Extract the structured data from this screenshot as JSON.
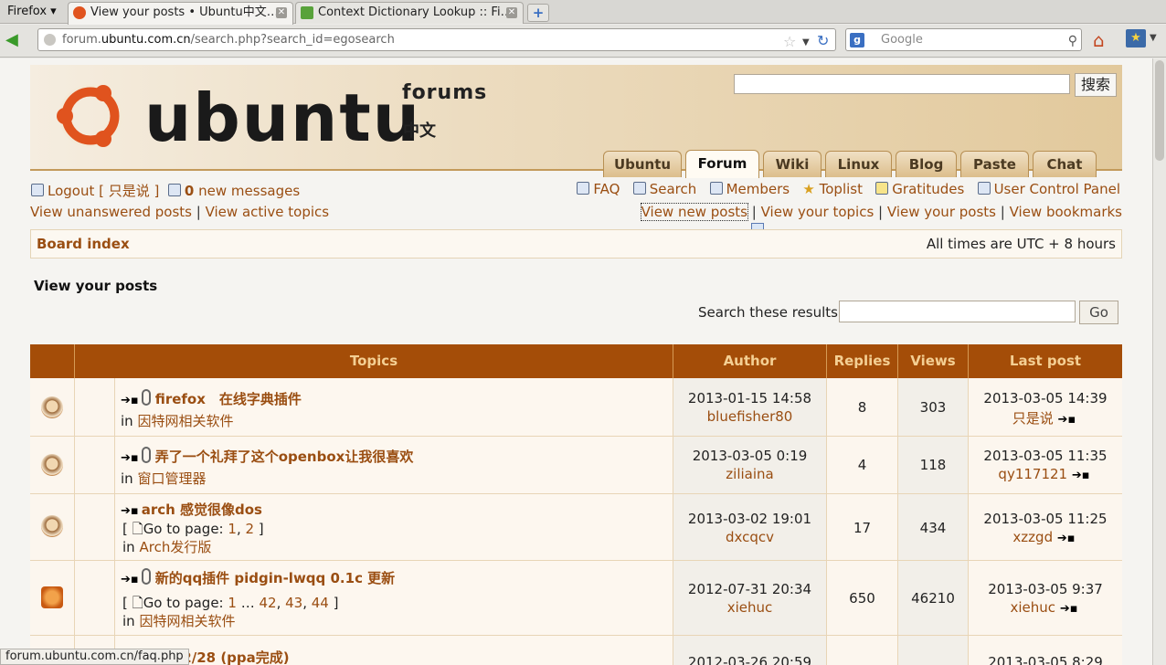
{
  "browser": {
    "menu_label": "Firefox",
    "tabs": [
      {
        "title": "View your posts • Ubuntu中文…",
        "active": true
      },
      {
        "title": "Context Dictionary Lookup :: Fi…",
        "active": false
      }
    ],
    "new_tab": "+",
    "url_prefix": "forum.",
    "url_domain": "ubuntu.com.cn",
    "url_path": "/search.php?search_id=egosearch",
    "search_placeholder": "Google",
    "status_url": "forum.ubuntu.com.cn/faq.php"
  },
  "header": {
    "logo_word": "ubuntu",
    "logo_forums": "forums",
    "logo_zh": "中文",
    "search_button": "搜索",
    "tabs": [
      "Ubuntu",
      "Forum",
      "Wiki",
      "Linux",
      "Blog",
      "Paste",
      "Chat"
    ],
    "active_tab": "Forum"
  },
  "userbar": {
    "logout": "Logout [ 只是说 ]",
    "new_count": "0",
    "new_messages": "new messages",
    "faq": "FAQ",
    "search": "Search",
    "members": "Members",
    "toplist": "Toplist",
    "gratitudes": "Gratitudes",
    "ucp": "User Control Panel",
    "unanswered": "View unanswered posts",
    "active": "View active topics",
    "new_posts": "View new posts",
    "your_topics": "View your topics",
    "your_posts": "View your posts",
    "bookmarks": "View bookmarks"
  },
  "breadcrumb": {
    "board_index": "Board index",
    "timezone": "All times are UTC + 8 hours"
  },
  "page_title": "View your posts",
  "search_results": {
    "label": "Search these results:",
    "button": "Go"
  },
  "table": {
    "headers": {
      "topics": "Topics",
      "author": "Author",
      "replies": "Replies",
      "views": "Views",
      "last_post": "Last post"
    },
    "rows": [
      {
        "title": "firefox　在线字典插件",
        "in": "in",
        "forum": "因特网相关软件",
        "date": "2013-01-15 14:58",
        "author": "bluefisher80",
        "replies": "8",
        "views": "303",
        "last_date": "2013-03-05 14:39",
        "last_user": "只是说"
      },
      {
        "title": "弄了一个礼拜了这个openbox让我很喜欢",
        "in": "in",
        "forum": "窗口管理器",
        "date": "2013-03-05 0:19",
        "author": "ziliaina",
        "replies": "4",
        "views": "118",
        "last_date": "2013-03-05 11:35",
        "last_user": "qy117121"
      },
      {
        "title": "arch 感觉很像dos",
        "goto": "Go to page:",
        "pages": [
          "1",
          "2"
        ],
        "in": "in",
        "forum": "Arch发行版",
        "date": "2013-03-02 19:01",
        "author": "dxcqcv",
        "replies": "17",
        "views": "434",
        "last_date": "2013-03-05 11:25",
        "last_user": "xzzgd"
      },
      {
        "title": "新的qq插件 pidgin-lwqq 0.1c 更新",
        "goto": "Go to page:",
        "pages": [
          "1",
          "42",
          "43",
          "44"
        ],
        "in": "in",
        "forum": "因特网相关软件",
        "date": "2012-07-31 20:34",
        "author": "xiehuc",
        "replies": "650",
        "views": "46210",
        "last_date": "2013-03-05 9:37",
        "last_user": "xiehuc"
      },
      {
        "title": "gtqq 2/28 (ppa完成)",
        "date": "2012-03-26 20:59",
        "last_date": "2013-03-05 8:29"
      }
    ]
  }
}
